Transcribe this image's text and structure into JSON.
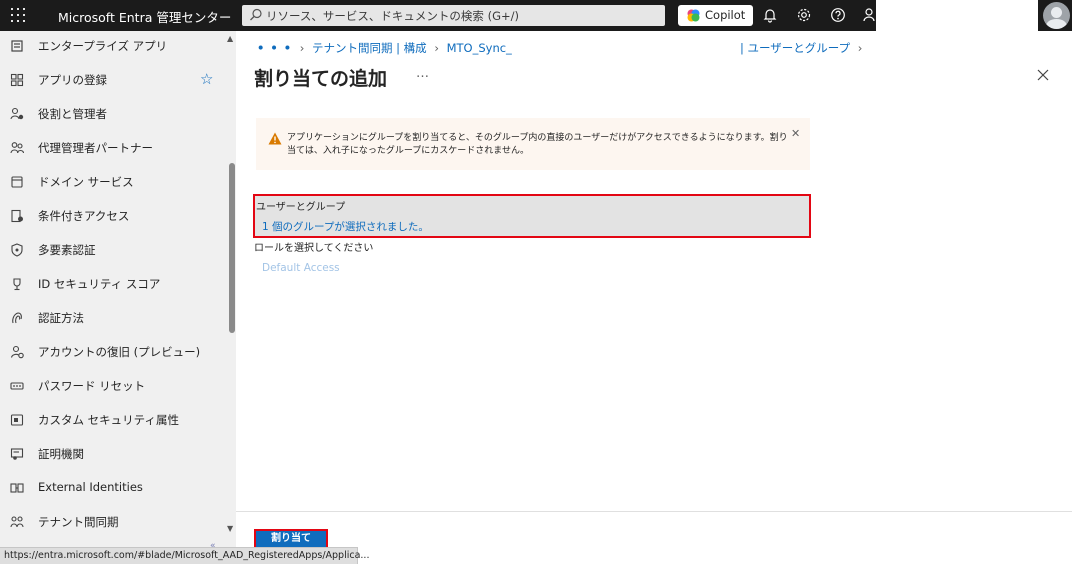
{
  "topbar": {
    "brand": "Microsoft Entra 管理センター",
    "search_placeholder": "リソース、サービス、ドキュメントの検索 (G+/)",
    "copilot_label": "Copilot"
  },
  "sidebar": {
    "items": [
      {
        "label": "エンタープライズ アプリ",
        "icon": "enterprise-app-icon"
      },
      {
        "label": "アプリの登録",
        "icon": "app-registration-icon",
        "favorite": true
      },
      {
        "label": "役割と管理者",
        "icon": "roles-icon"
      },
      {
        "label": "代理管理者パートナー",
        "icon": "partners-icon"
      },
      {
        "label": "ドメイン サービス",
        "icon": "domain-icon"
      },
      {
        "label": "条件付きアクセス",
        "icon": "conditional-access-icon"
      },
      {
        "label": "多要素認証",
        "icon": "mfa-shield-icon"
      },
      {
        "label": "ID セキュリティ スコア",
        "icon": "trophy-icon"
      },
      {
        "label": "認証方法",
        "icon": "auth-methods-icon"
      },
      {
        "label": "アカウントの復旧 (プレビュー)",
        "icon": "account-recovery-icon"
      },
      {
        "label": "パスワード リセット",
        "icon": "password-icon"
      },
      {
        "label": "カスタム セキュリティ属性",
        "icon": "custom-attr-icon"
      },
      {
        "label": "証明機関",
        "icon": "certificate-icon"
      },
      {
        "label": "External Identities",
        "icon": "external-identities-icon"
      },
      {
        "label": "テナント間同期",
        "icon": "cross-tenant-sync-icon"
      }
    ]
  },
  "breadcrumb": {
    "ellipsis": "• • •",
    "items": [
      "テナント間同期 | 構成",
      "MTO_Sync_"
    ],
    "tail": "| ユーザーとグループ"
  },
  "page": {
    "title": "割り当ての追加",
    "more": "…"
  },
  "warning": {
    "text": "アプリケーションにグループを割り当てると、そのグループ内の直接のユーザーだけがアクセスできるようになります。割り当ては、入れ子になったグループにカスケードされません。"
  },
  "form": {
    "users_groups_label": "ユーザーとグループ",
    "users_groups_value": "1 個のグループが選択されました。",
    "role_label": "ロールを選択してください",
    "role_value": "Default Access"
  },
  "footer": {
    "assign_label": "割り当て"
  },
  "status_bar": {
    "url": "https://entra.microsoft.com/#blade/Microsoft_AAD_RegisteredApps/Applica..."
  },
  "colors": {
    "accent": "#0f6cbd",
    "highlight": "#e30613",
    "warning": "#d97a00",
    "topbar": "#1b1b1b"
  }
}
